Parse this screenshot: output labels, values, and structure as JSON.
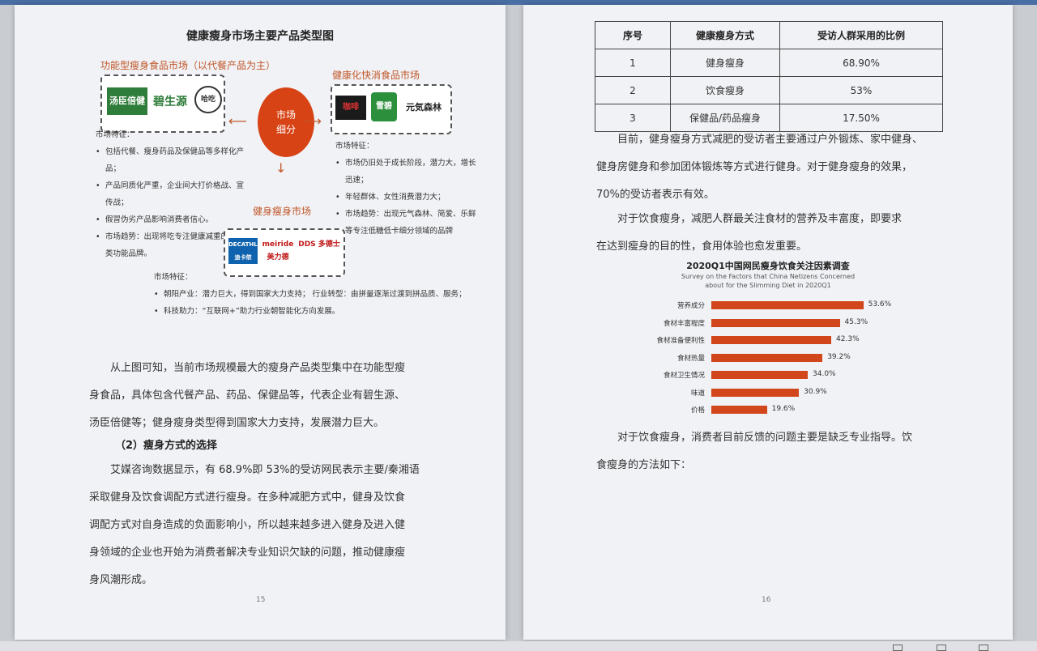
{
  "left_page": {
    "title": "健康瘦身市场主要产品类型图",
    "functional": {
      "heading": "功能型瘦身食品市场（以代餐产品为主）",
      "logos": [
        "汤臣倍健",
        "碧生源",
        "哈吃"
      ],
      "features_title": "市场特征：",
      "features": [
        "包括代餐、瘦身药品及保健品等多样化产品；",
        "产品同质化严重，企业间大打价格战、宣传战；",
        "假冒伪劣产品影响消费者信心。",
        "市场趋势：出现将吃专注健康减重的新品类功能品牌。"
      ]
    },
    "fastmoving": {
      "heading": "健康化快消食品市场",
      "logos": [
        "咖啡",
        "雪碧",
        "元気森林"
      ],
      "features_title": "市场特征：",
      "features": [
        "市场仍旧处于成长阶段，潜力大，增长迅速；",
        "年轻群体、女性消费潜力大；",
        "市场趋势：出现元气森林、简爱、乐鲜等专注低糖低卡细分领域的品牌"
      ]
    },
    "center": {
      "line1": "市场",
      "line2": "细分"
    },
    "fitness": {
      "heading": "健身瘦身市场",
      "logos": [
        "DECATHLON 迪卡侬",
        "meiride 美力德",
        "DDS 多德士"
      ],
      "features_title": "市场特征：",
      "features": [
        "朝阳产业：潜力巨大，得到国家大力支持；  行业转型：由拼量逐渐过渡到拼品质、服务；",
        "科技助力：“互联网+”助力行业朝智能化方向发展。"
      ]
    },
    "para1": [
      "从上图可知，当前市场规模最大的瘦身产品类型集中在功能型瘦",
      "身食品，具体包含代餐产品、药品、保健品等，代表企业有碧生源、",
      "汤臣倍健等；健身瘦身类型得到国家大力支持，发展潜力巨大。"
    ],
    "heading2": "（2）瘦身方式的选择",
    "para2": [
      "艾媒咨询数据显示，有 68.9%即 53%的受访网民表示主要/秦湘语",
      "采取健身及饮食调配方式进行瘦身。在多种减肥方式中，健身及饮食",
      "调配方式对自身造成的负面影响小，所以越来越多进入健身及进入健",
      "身领域的企业也开始为消费者解决专业知识欠缺的问题，推动健康瘦",
      "身风潮形成。"
    ],
    "page_number": "15"
  },
  "right_page": {
    "table": {
      "headers": [
        "序号",
        "健康瘦身方式",
        "受访人群采用的比例"
      ],
      "rows": [
        [
          "1",
          "健身瘦身",
          "68.90%"
        ],
        [
          "2",
          "饮食瘦身",
          "53%"
        ],
        [
          "3",
          "保健品/药品瘦身",
          "17.50%"
        ]
      ]
    },
    "para1": [
      "目前，健身瘦身方式减肥的受访者主要通过户外锻炼、家中健身、",
      "健身房健身和参加团体锻炼等方式进行健身。对于健身瘦身的效果，",
      "70%的受访者表示有效。"
    ],
    "para2": [
      "对于饮食瘦身，减肥人群最关注食材的营养及丰富度，即要求",
      "在达到瘦身的目的性，食用体验也愈发重要。"
    ],
    "para3": [
      "对于饮食瘦身，消费者目前反馈的问题主要是缺乏专业指导。饮",
      "食瘦身的方法如下："
    ],
    "page_number": "16"
  },
  "chart_data": {
    "type": "bar",
    "title": "2020Q1中国网民瘦身饮食关注因素调查",
    "subtitle": "Survey on the Factors that China Netizens Concerned about for the Slimming Diet in 2020Q1",
    "categories": [
      "营养成分",
      "食材丰富程度",
      "食材准备便利性",
      "食材热量",
      "食材卫生情况",
      "味道",
      "价格"
    ],
    "values": [
      53.6,
      45.3,
      42.3,
      39.2,
      34.0,
      30.9,
      19.6
    ],
    "value_labels": [
      "53.6%",
      "45.3%",
      "42.3%",
      "39.2%",
      "34.0%",
      "30.9%",
      "19.6%"
    ],
    "orientation": "horizontal",
    "bar_color": "#d2461b",
    "xlim": [
      0,
      60
    ]
  }
}
